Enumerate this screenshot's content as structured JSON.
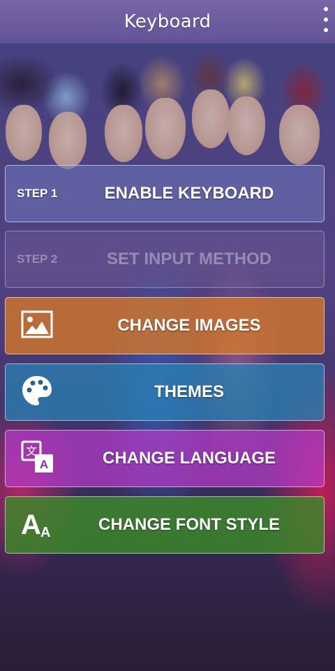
{
  "app_bar": {
    "title": "Keyboard",
    "overflow_icon": "more-vert-icon"
  },
  "buttons": {
    "enable_keyboard": {
      "step": "STEP 1",
      "label": "ENABLE KEYBOARD",
      "enabled": true
    },
    "set_input_method": {
      "step": "STEP 2",
      "label": "SET INPUT METHOD",
      "enabled": false
    },
    "change_images": {
      "label": "CHANGE IMAGES",
      "icon": "image-icon"
    },
    "themes": {
      "label": "THEMES",
      "icon": "palette-icon"
    },
    "change_language": {
      "label": "CHANGE LANGUAGE",
      "icon": "translate-icon"
    },
    "change_font_style": {
      "label": "CHANGE FONT STYLE",
      "icon": "font-size-icon"
    }
  },
  "colors": {
    "images": "#d77828",
    "themes": "#2882b4",
    "language": "#b43cc8",
    "font": "#3c8c28"
  }
}
